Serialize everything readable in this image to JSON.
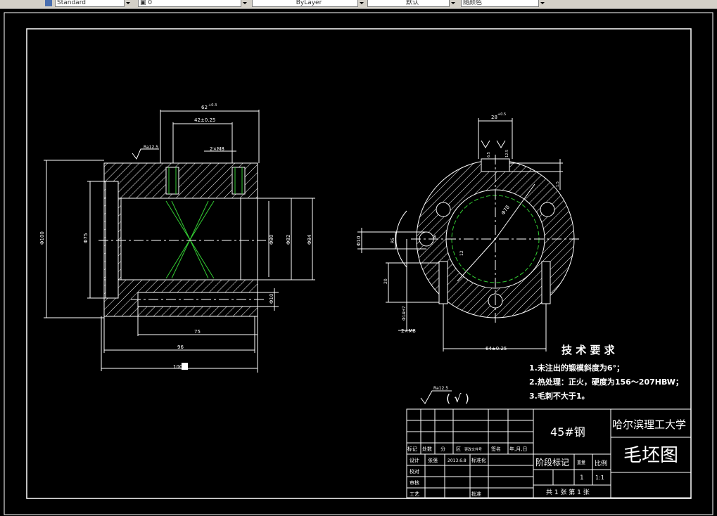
{
  "toolbar": {
    "text_style": "Standard",
    "layer": "0",
    "linetype": "ByLayer",
    "lineweight": "默认",
    "plot_style": "随颜色"
  },
  "drawing": {
    "left_view": {
      "dim_top_outer": "62",
      "dim_top_outer_tol": "+0.3",
      "dim_top_inner": "42±0.25",
      "holes_note": "2×M8",
      "roughness": "Ra12.5",
      "dia_outer": "Φ100",
      "dia_bore_left": "Φ75",
      "dia_bore_a": "Φ80",
      "dia_bore_b": "Φ82",
      "dia_bore_c": "Φ84",
      "dia_hole": "Φ10",
      "len_75": "75",
      "len_96": "96",
      "len_100": "100"
    },
    "right_view": {
      "dim_top": "28",
      "dim_top_tol": "+0.5",
      "dim_side_small": "6.5",
      "dim_side_b": "12.5",
      "dim_1_5": "1.5",
      "dim_8": "8",
      "dim_10": "Φ10",
      "dim_r5": "R5",
      "dim_20": "20",
      "dim_hole": "Φ14H7",
      "dim_78": "Φ78",
      "dim_12": "12",
      "holes_note": "2×M8",
      "dim_bottom": "64±0.25"
    },
    "tech_req": {
      "title": "技 术 要 求",
      "items": [
        "1.未注出的锻模斜度为6°；",
        "2.热处理：正火，硬度为156～207HBW；",
        "3.毛刺不大于1。"
      ]
    },
    "roughness_note": {
      "value": "Ra12.5",
      "paren": "( √ )"
    },
    "title_block": {
      "material": "45#钢",
      "university": "哈尔滨理工大学",
      "drawing_name": "毛坯图",
      "header_row": [
        "标记",
        "处数",
        "分",
        "区",
        "更改文件号",
        "签名",
        "年,月,日"
      ],
      "design_label": "设计",
      "designer": "张强",
      "design_date": "2013.6.8",
      "standardize": "标准化",
      "check_label": "校对",
      "review_label": "审核",
      "process_label": "工艺",
      "approve": "批准",
      "stage_label": "阶段标记",
      "weight_label": "重量",
      "scale_label": "比例",
      "qty": "1",
      "scale": "1:1",
      "sheets": "共 1 张  第 1 张"
    }
  }
}
